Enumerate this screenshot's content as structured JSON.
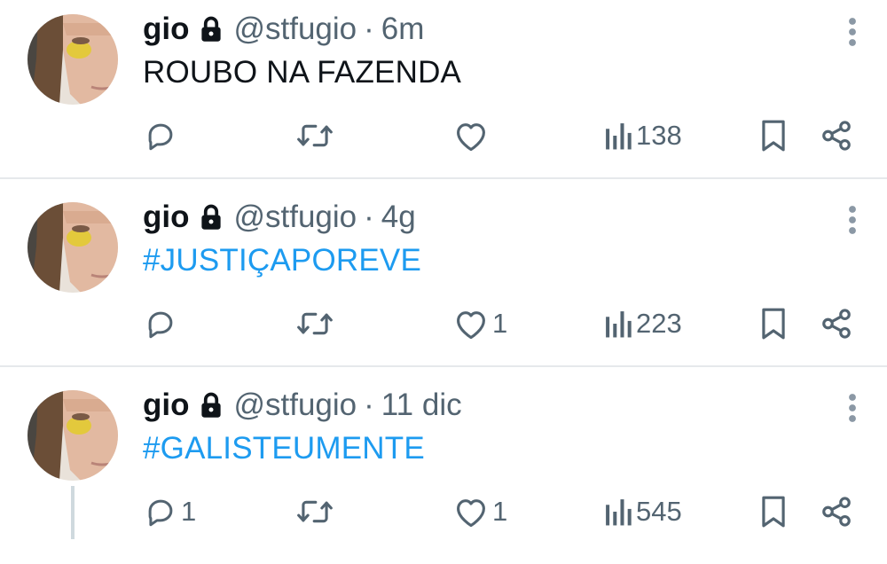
{
  "tweets": [
    {
      "name": "gio",
      "handle": "@stfugio",
      "separator": "·",
      "time": "6m",
      "text": "ROUBO NA FAZENDA",
      "is_link": false,
      "replies": "",
      "retweets": "",
      "likes": "",
      "views": "138"
    },
    {
      "name": "gio",
      "handle": "@stfugio",
      "separator": "·",
      "time": "4g",
      "text": "#JUSTIÇAPOREVE",
      "is_link": true,
      "replies": "",
      "retweets": "",
      "likes": "1",
      "views": "223"
    },
    {
      "name": "gio",
      "handle": "@stfugio",
      "separator": "·",
      "time": "11 dic",
      "text": "#GALISTEUMENTE",
      "is_link": true,
      "replies": "1",
      "retweets": "",
      "likes": "1",
      "views": "545"
    }
  ],
  "icons": {
    "reply": "speech-bubble-icon",
    "retweet": "retweet-icon",
    "like": "heart-icon",
    "views": "bar-chart-icon",
    "bookmark": "bookmark-icon",
    "share": "share-icon",
    "more": "vertical-ellipsis-icon",
    "protected": "lock-icon"
  },
  "colors": {
    "text": "#0f1419",
    "secondary": "#536471",
    "link": "#1d9bf0",
    "divider": "#e6e9eb"
  }
}
